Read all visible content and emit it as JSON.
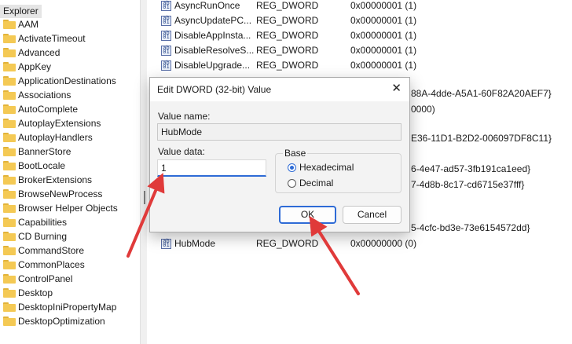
{
  "tree": {
    "root_label": "Explorer",
    "items": [
      {
        "label": "AAM"
      },
      {
        "label": "ActivateTimeout"
      },
      {
        "label": "Advanced"
      },
      {
        "label": "AppKey"
      },
      {
        "label": "ApplicationDestinations"
      },
      {
        "label": "Associations"
      },
      {
        "label": "AutoComplete"
      },
      {
        "label": "AutoplayExtensions"
      },
      {
        "label": "AutoplayHandlers"
      },
      {
        "label": "BannerStore"
      },
      {
        "label": "BootLocale"
      },
      {
        "label": "BrokerExtensions"
      },
      {
        "label": "BrowseNewProcess"
      },
      {
        "label": "Browser Helper Objects"
      },
      {
        "label": "Capabilities"
      },
      {
        "label": "CD Burning"
      },
      {
        "label": "CommandStore"
      },
      {
        "label": "CommonPlaces"
      },
      {
        "label": "ControlPanel"
      },
      {
        "label": "Desktop"
      },
      {
        "label": "DesktopIniPropertyMap"
      },
      {
        "label": "DesktopOptimization"
      }
    ]
  },
  "values": {
    "rows": [
      {
        "name": "AsyncRunOnce",
        "type": "REG_DWORD",
        "data": "0x00000001 (1)"
      },
      {
        "name": "AsyncUpdatePC...",
        "type": "REG_DWORD",
        "data": "0x00000001 (1)"
      },
      {
        "name": "DisableAppInsta...",
        "type": "REG_DWORD",
        "data": "0x00000001 (1)"
      },
      {
        "name": "DisableResolveS...",
        "type": "REG_DWORD",
        "data": "0x00000001 (1)"
      },
      {
        "name": "DisableUpgrade...",
        "type": "REG_DWORD",
        "data": "0x00000001 (1)"
      }
    ],
    "partial_data": [
      "88A-4dde-A5A1-60F82A20AEF7}",
      "0000)",
      "E36-11D1-B2D2-006097DF8C11}",
      "6-4e47-ad57-3fb191ca1eed}",
      "7-4d8b-8c17-cd6715e37fff}",
      "5-4cfc-bd3e-73e6154572dd}"
    ],
    "highlight_row": {
      "name": "HubMode",
      "type": "REG_DWORD",
      "data": "0x00000000 (0)"
    },
    "icon_text": "ab\n01"
  },
  "dialog": {
    "title": "Edit DWORD (32-bit) Value",
    "close_glyph": "✕",
    "value_name_label": "Value name:",
    "value_name": "HubMode",
    "value_data_label": "Value data:",
    "value_data": "1",
    "base_label": "Base",
    "base_options": [
      {
        "label": "Hexadecimal",
        "selected": true
      },
      {
        "label": "Decimal",
        "selected": false
      }
    ],
    "ok_label": "OK",
    "cancel_label": "Cancel"
  },
  "colors": {
    "arrow": "#e03a3a",
    "accent": "#2e6bd6",
    "folder": "#f4c954"
  }
}
